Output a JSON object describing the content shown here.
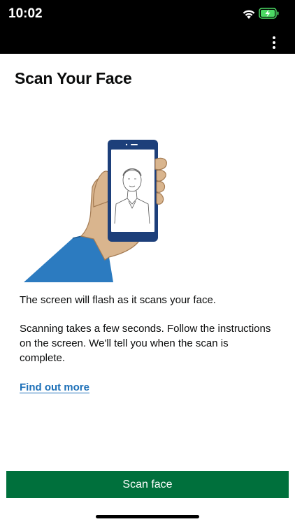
{
  "status_bar": {
    "time": "10:02",
    "icons": [
      "wifi-icon",
      "battery-charging-icon"
    ],
    "battery_color": "#4cd964"
  },
  "app_bar": {
    "menu_icon": "more-vertical-icon"
  },
  "main": {
    "title": "Scan Your Face",
    "illustration_icon": "hand-holding-phone-face-scan-illustration",
    "paragraph_1": "The screen will flash as it scans your face.",
    "paragraph_2": "Scanning takes a few seconds. Follow the instructions on the screen. We'll tell you when the scan is complete.",
    "link_label": "Find out more"
  },
  "footer": {
    "button_label": "Scan face"
  },
  "colors": {
    "primary_button": "#00703c",
    "link": "#1d70b8",
    "sleeve": "#2c7bc0",
    "skin": "#d9b58e",
    "phone_frame": "#1d3f7a"
  }
}
